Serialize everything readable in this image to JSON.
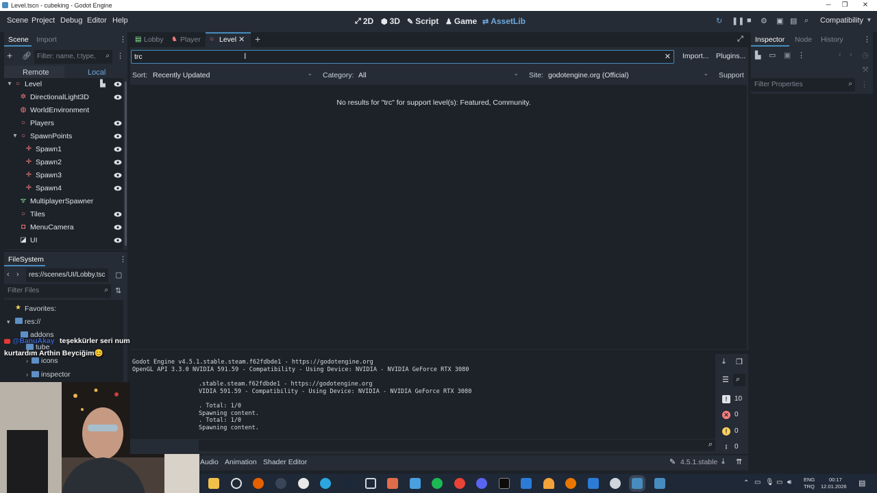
{
  "window": {
    "title": "Level.tscn - cubeking - Godot Engine",
    "controls": [
      "─",
      "❐",
      "✕"
    ]
  },
  "menu": [
    "Scene",
    "Project",
    "Debug",
    "Editor",
    "Help"
  ],
  "workspaces": {
    "w2d": "2D",
    "w3d": "3D",
    "script": "Script",
    "game": "Game",
    "assetlib": "AssetLib"
  },
  "renderer": "Compatibility",
  "scene_dock": {
    "tabs": {
      "scene": "Scene",
      "import": "Import"
    },
    "filter_placeholder": "Filter: name, t:type,",
    "remote": "Remote",
    "local": "Local",
    "nodes": [
      {
        "name": "Level"
      },
      {
        "name": "DirectionalLight3D"
      },
      {
        "name": "WorldEnvironment"
      },
      {
        "name": "Players"
      },
      {
        "name": "SpawnPoints"
      },
      {
        "name": "Spawn1"
      },
      {
        "name": "Spawn2"
      },
      {
        "name": "Spawn3"
      },
      {
        "name": "Spawn4"
      },
      {
        "name": "MultiplayerSpawner"
      },
      {
        "name": "Tiles"
      },
      {
        "name": "MenuCamera"
      },
      {
        "name": "UI"
      }
    ]
  },
  "filesystem": {
    "title": "FileSystem",
    "path": "res://scenes/UI/Lobby.tsc",
    "filter_placeholder": "Filter Files",
    "favorites": "Favorites:",
    "res": "res://",
    "addons": "addons",
    "tube": "tube",
    "icons": "icons",
    "inspector": "inspector"
  },
  "chat": {
    "user": "@BanuAkay",
    "line1": "teşekkürler seri numaradan",
    "line2": "kurtardım Arthin Beyciğim😊"
  },
  "scene_tabs": {
    "lobby": "Lobby",
    "player": "Player",
    "level": "Level"
  },
  "assetlib": {
    "search_value": "trc",
    "import": "Import...",
    "plugins": "Plugins...",
    "sort_label": "Sort:",
    "sort_value": "Recently Updated",
    "category_label": "Category:",
    "category_value": "All",
    "site_label": "Site:",
    "site_value": "godotengine.org (Official)",
    "support": "Support",
    "no_results": "No results for \"trc\" for support level(s): Featured, Community."
  },
  "console": {
    "lines": [
      "Godot Engine v4.5.1.stable.steam.f62fdbde1 - https://godotengine.org",
      "OpenGL API 3.3.0 NVIDIA 591.59 - Compatibility - Using Device: NVIDIA - NVIDIA GeForce RTX 3080",
      "",
      ".stable.steam.f62fdbde1 - https://godotengine.org",
      "VIDIA 591.59 - Compatibility - Using Device: NVIDIA - NVIDIA GeForce RTX 3080",
      "",
      ". Total: 1/0",
      "Spawning content.",
      ". Total: 1/0",
      "Spawning content."
    ],
    "counts": {
      "messages": "10",
      "errors": "0",
      "warnings": "0",
      "info": "0"
    }
  },
  "bottom_tabs": {
    "audio": "Audio",
    "animation": "Animation",
    "shader": "Shader Editor"
  },
  "version": "4.5.1.stable",
  "inspector": {
    "tab_inspector": "Inspector",
    "tab_node": "Node",
    "tab_history": "History",
    "filter_placeholder": "Filter Properties"
  },
  "tray": {
    "lang1": "ENG",
    "lang2": "TRQ",
    "time": "00:17",
    "date": "12.01.2026"
  },
  "colors": {
    "accent": "#478cbf",
    "panel": "#262c35",
    "base": "#1d2229",
    "node_red": "#fc7f7f"
  }
}
